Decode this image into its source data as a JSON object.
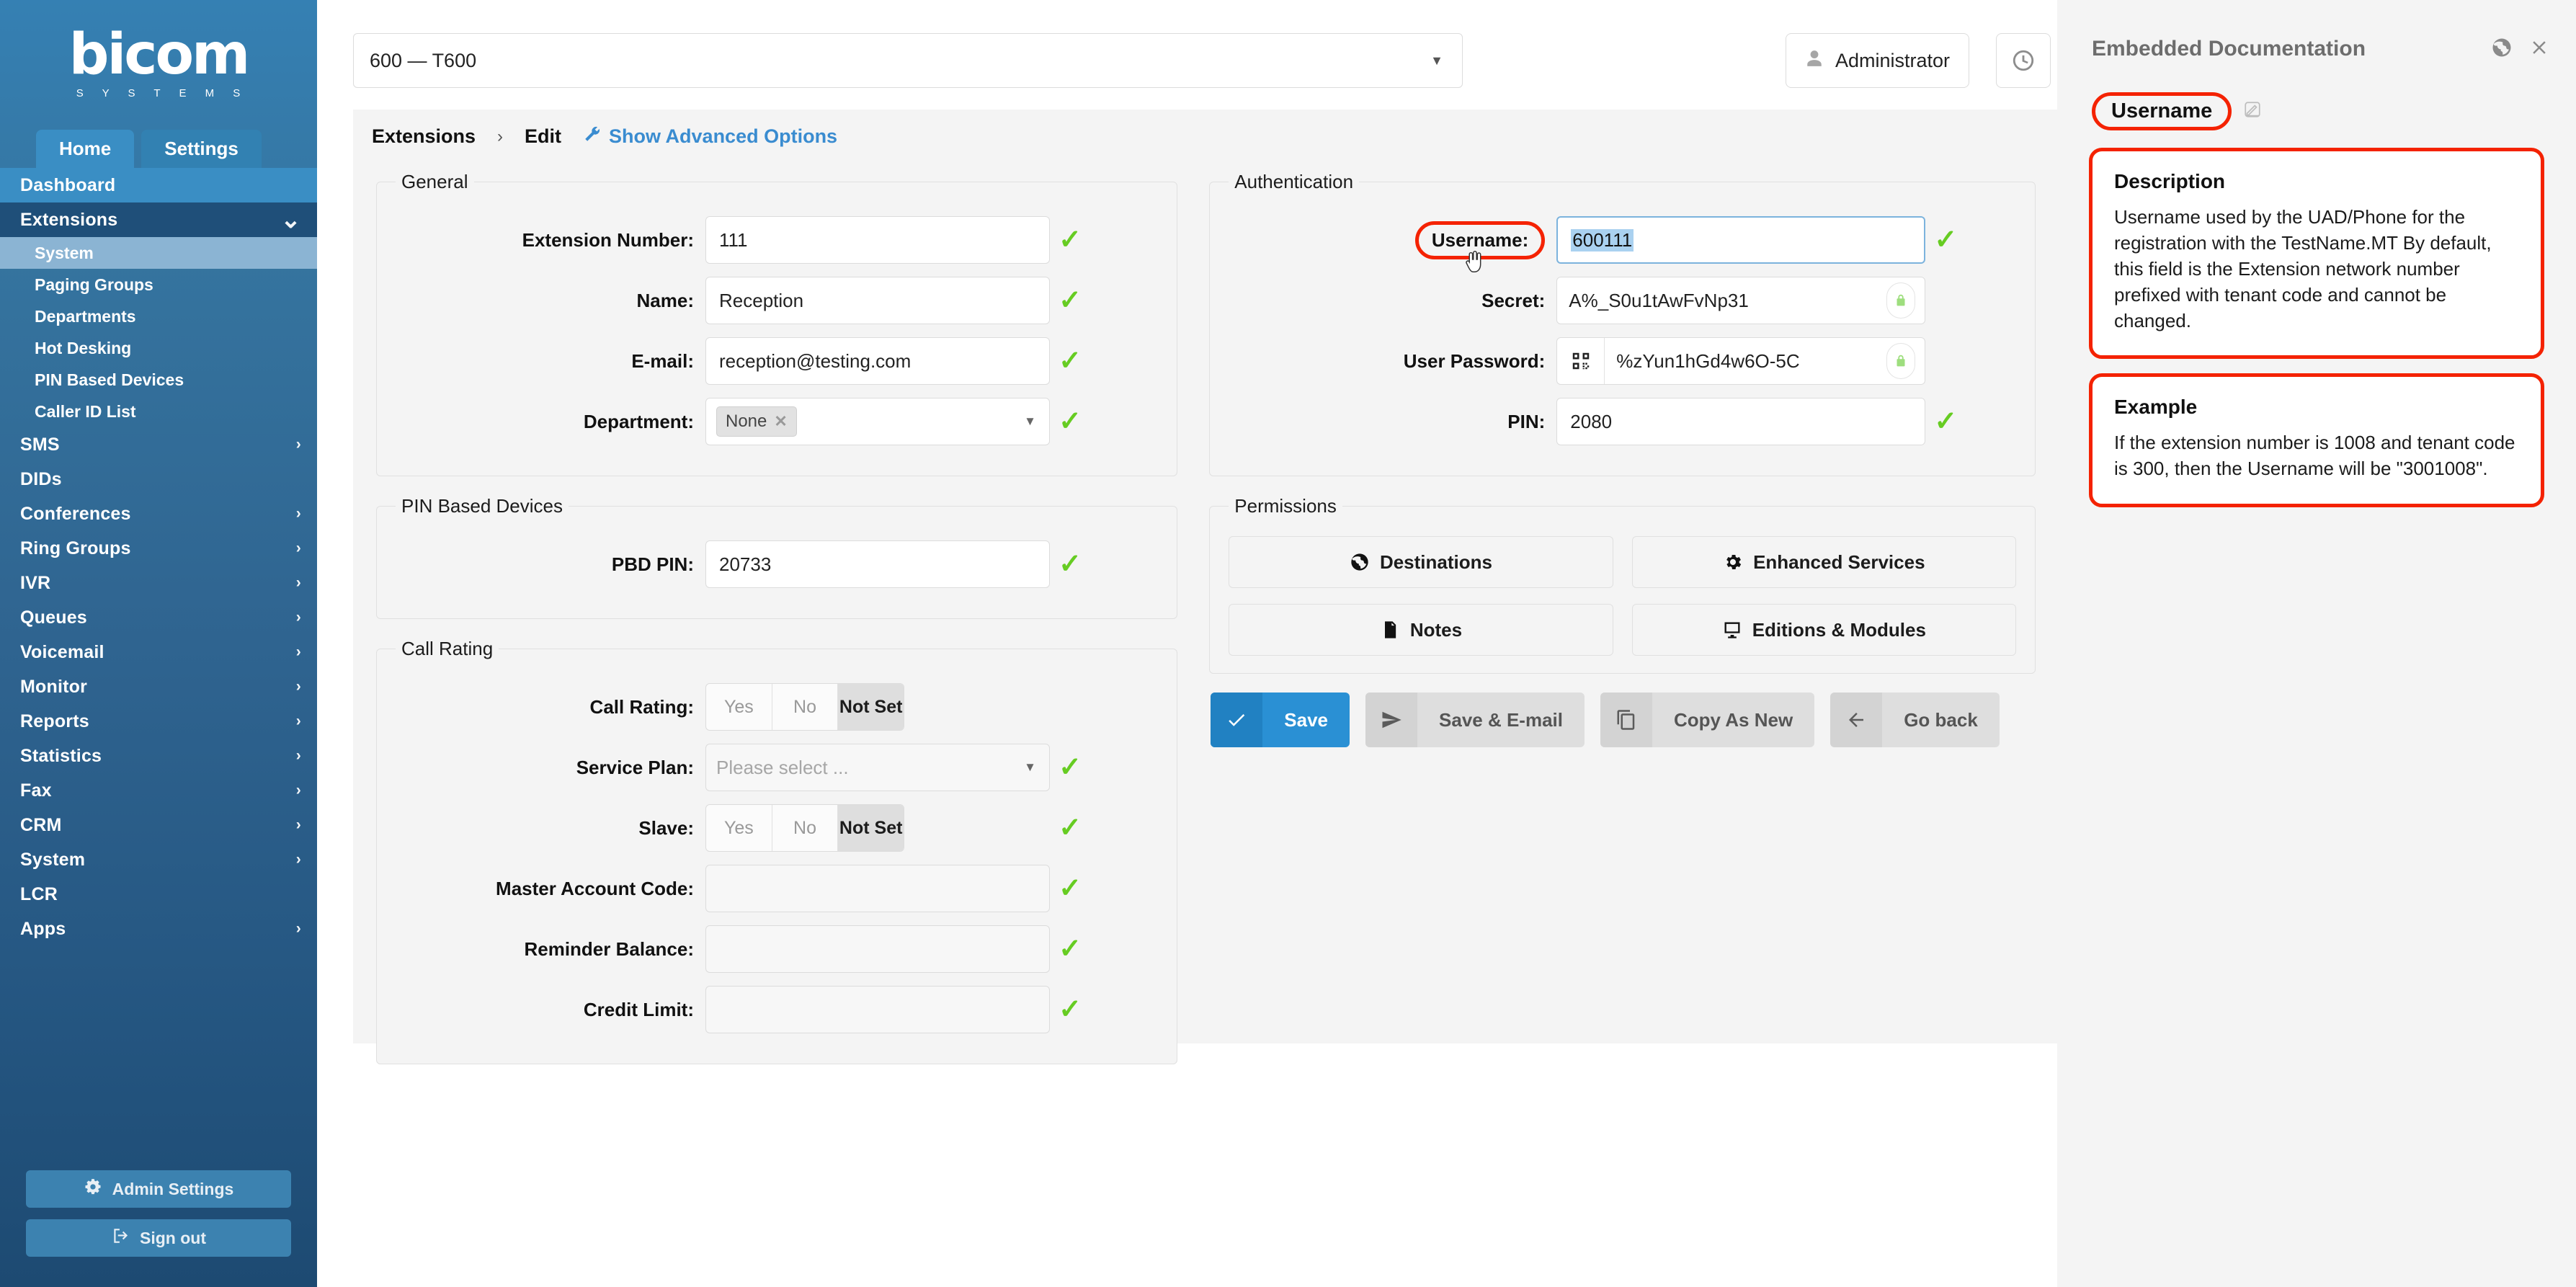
{
  "brand": {
    "name": "bicom",
    "tagline": "S Y S T E M S"
  },
  "sidebar": {
    "tabs": [
      {
        "label": "Home",
        "active": true
      },
      {
        "label": "Settings",
        "active": false
      }
    ],
    "items": [
      {
        "label": "Dashboard",
        "level": "top",
        "state": "highlight",
        "chevron": ""
      },
      {
        "label": "Extensions",
        "level": "top",
        "state": "expanded",
        "chevron": "chevron-down-icon"
      },
      {
        "label": "System",
        "level": "sub",
        "state": "selected",
        "chevron": ""
      },
      {
        "label": "Paging Groups",
        "level": "sub",
        "state": "",
        "chevron": ""
      },
      {
        "label": "Departments",
        "level": "sub",
        "state": "",
        "chevron": ""
      },
      {
        "label": "Hot Desking",
        "level": "sub",
        "state": "",
        "chevron": ""
      },
      {
        "label": "PIN Based Devices",
        "level": "sub",
        "state": "",
        "chevron": ""
      },
      {
        "label": "Caller ID List",
        "level": "sub",
        "state": "",
        "chevron": ""
      },
      {
        "label": "SMS",
        "level": "top",
        "state": "",
        "chevron": "chevron-right-icon"
      },
      {
        "label": "DIDs",
        "level": "top",
        "state": "",
        "chevron": ""
      },
      {
        "label": "Conferences",
        "level": "top",
        "state": "",
        "chevron": "chevron-right-icon"
      },
      {
        "label": "Ring Groups",
        "level": "top",
        "state": "",
        "chevron": "chevron-right-icon"
      },
      {
        "label": "IVR",
        "level": "top",
        "state": "",
        "chevron": "chevron-right-icon"
      },
      {
        "label": "Queues",
        "level": "top",
        "state": "",
        "chevron": "chevron-right-icon"
      },
      {
        "label": "Voicemail",
        "level": "top",
        "state": "",
        "chevron": "chevron-right-icon"
      },
      {
        "label": "Monitor",
        "level": "top",
        "state": "",
        "chevron": "chevron-right-icon"
      },
      {
        "label": "Reports",
        "level": "top",
        "state": "",
        "chevron": "chevron-right-icon"
      },
      {
        "label": "Statistics",
        "level": "top",
        "state": "",
        "chevron": "chevron-right-icon"
      },
      {
        "label": "Fax",
        "level": "top",
        "state": "",
        "chevron": "chevron-right-icon"
      },
      {
        "label": "CRM",
        "level": "top",
        "state": "",
        "chevron": "chevron-right-icon"
      },
      {
        "label": "System",
        "level": "top",
        "state": "",
        "chevron": "chevron-right-icon"
      },
      {
        "label": "LCR",
        "level": "top",
        "state": "",
        "chevron": ""
      },
      {
        "label": "Apps",
        "level": "top",
        "state": "",
        "chevron": "chevron-right-icon"
      }
    ],
    "admin_settings_label": "Admin Settings",
    "sign_out_label": "Sign out"
  },
  "topbar": {
    "extension_selector_value": "600  —  T600",
    "admin_label": "Administrator",
    "icons": [
      {
        "name": "clock-icon",
        "color": "#8d8d8d"
      },
      {
        "name": "life-ring-icon",
        "color": "#8d8d8d"
      },
      {
        "name": "globe-icon",
        "color": "#8d8d8d"
      },
      {
        "name": "refresh-icon",
        "color": "#57c22d"
      },
      {
        "name": "sync-icon",
        "color": "#57c22d"
      },
      {
        "name": "help-question-icon",
        "color": "#8d8d8d"
      }
    ]
  },
  "breadcrumb": {
    "root": "Extensions",
    "separator": "›",
    "current": "Edit",
    "advanced_link": "Show Advanced Options"
  },
  "general": {
    "legend": "General",
    "fields": [
      {
        "label": "Extension Number:",
        "value": "111",
        "valid": true
      },
      {
        "label": "Name:",
        "value": "Reception",
        "valid": true
      },
      {
        "label": "E-mail:",
        "value": "reception@testing.com",
        "valid": true
      }
    ],
    "department": {
      "label": "Department:",
      "chip": "None",
      "valid": true
    }
  },
  "pin_based_devices": {
    "legend": "PIN Based Devices",
    "pbd_pin": {
      "label": "PBD PIN:",
      "value": "20733",
      "valid": true
    }
  },
  "call_rating": {
    "legend": "Call Rating",
    "call_rating": {
      "label": "Call Rating:",
      "options": [
        "Yes",
        "No",
        "Not Set"
      ],
      "selected": "Not Set"
    },
    "service_plan": {
      "label": "Service Plan:",
      "placeholder": "Please select ...",
      "valid": true
    },
    "slave": {
      "label": "Slave:",
      "options": [
        "Yes",
        "No",
        "Not Set"
      ],
      "selected": "Not Set",
      "valid": true
    },
    "master_account_code": {
      "label": "Master Account Code:",
      "value": "",
      "valid": true
    },
    "reminder_balance": {
      "label": "Reminder Balance:",
      "value": "",
      "valid": true
    },
    "credit_limit": {
      "label": "Credit Limit:",
      "value": "",
      "valid": true
    }
  },
  "authentication": {
    "legend": "Authentication",
    "username": {
      "label": "Username:",
      "value": "600111",
      "valid": true,
      "highlighted": true
    },
    "secret": {
      "label": "Secret:",
      "value": "A%_S0u1tAwFvNp31",
      "locked": true
    },
    "user_password": {
      "label": "User Password:",
      "value": "%zYun1hGd4w6O-5C",
      "locked": true,
      "qr": "qr-code-icon"
    },
    "pin": {
      "label": "PIN:",
      "value": "2080",
      "valid": true
    }
  },
  "permissions": {
    "legend": "Permissions",
    "buttons": [
      {
        "label": "Destinations",
        "icon": "globe-icon"
      },
      {
        "label": "Enhanced Services",
        "icon": "gear-icon"
      },
      {
        "label": "Notes",
        "icon": "note-icon"
      },
      {
        "label": "Editions & Modules",
        "icon": "monitor-icon"
      }
    ]
  },
  "actions": [
    {
      "label": "Save",
      "icon": "check-icon",
      "style": "primary"
    },
    {
      "label": "Save & E-mail",
      "icon": "send-icon",
      "style": "grey"
    },
    {
      "label": "Copy As New",
      "icon": "copy-icon",
      "style": "grey"
    },
    {
      "label": "Go back",
      "icon": "arrow-left-icon",
      "style": "grey"
    }
  ],
  "documentation": {
    "panel_title": "Embedded Documentation",
    "header_icons": [
      {
        "name": "globe-icon"
      },
      {
        "name": "close-icon"
      }
    ],
    "field_name": "Username",
    "edit_icon": "pencil-icon",
    "description": {
      "heading": "Description",
      "body": "Username used by the UAD/Phone for the registration with the TestName.MT By default, this field is the Extension network number prefixed with tenant code and cannot be changed."
    },
    "example": {
      "heading": "Example",
      "body": "If the extension number is 1008 and tenant code is 300, then the Username will be \"3001008\"."
    }
  },
  "colors": {
    "brand_blue": "#3580b3",
    "accent_blue": "#2a90d4",
    "valid_green": "#66cc22",
    "annotation_red": "#f42200"
  }
}
